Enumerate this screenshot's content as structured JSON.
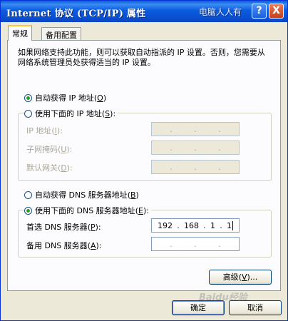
{
  "window": {
    "title": "Internet 协议 (TCP/IP) 属性",
    "watermark_top": "电脑人人有",
    "help_glyph": "?",
    "close_glyph": "X"
  },
  "tabs": [
    {
      "label": "常规",
      "active": true
    },
    {
      "label": "备用配置",
      "active": false
    }
  ],
  "description": "如果网络支持此功能，则可以获取自动指派的 IP 设置。否则，您需要从网络系统管理员处获得适当的 IP 设置。",
  "ip_section": {
    "auto_label": "自动获得 IP 地址(O)",
    "auto_label_text": "自动获得 IP 地址",
    "auto_key": "O",
    "manual_label_text": "使用下面的 IP 地址",
    "manual_key": "S",
    "selected": "auto",
    "fields": [
      {
        "label": "IP 地址",
        "key": "I"
      },
      {
        "label": "子网掩码",
        "key": "U"
      },
      {
        "label": "默认网关",
        "key": "D"
      }
    ]
  },
  "dns_section": {
    "auto_label_text": "自动获得 DNS 服务器地址",
    "auto_key": "B",
    "manual_label_text": "使用下面的 DNS 服务器地址",
    "manual_key": "E",
    "selected": "manual",
    "preferred_label": "首选 DNS 服务器",
    "preferred_key": "P",
    "preferred_octets": [
      "192",
      "168",
      "1",
      "1"
    ],
    "alternate_label": "备用 DNS 服务器",
    "alternate_key": "A"
  },
  "buttons": {
    "advanced": "高级",
    "advanced_key": "V",
    "ok": "确定",
    "cancel": "取消"
  },
  "watermark_bottom": "Baidu经验"
}
